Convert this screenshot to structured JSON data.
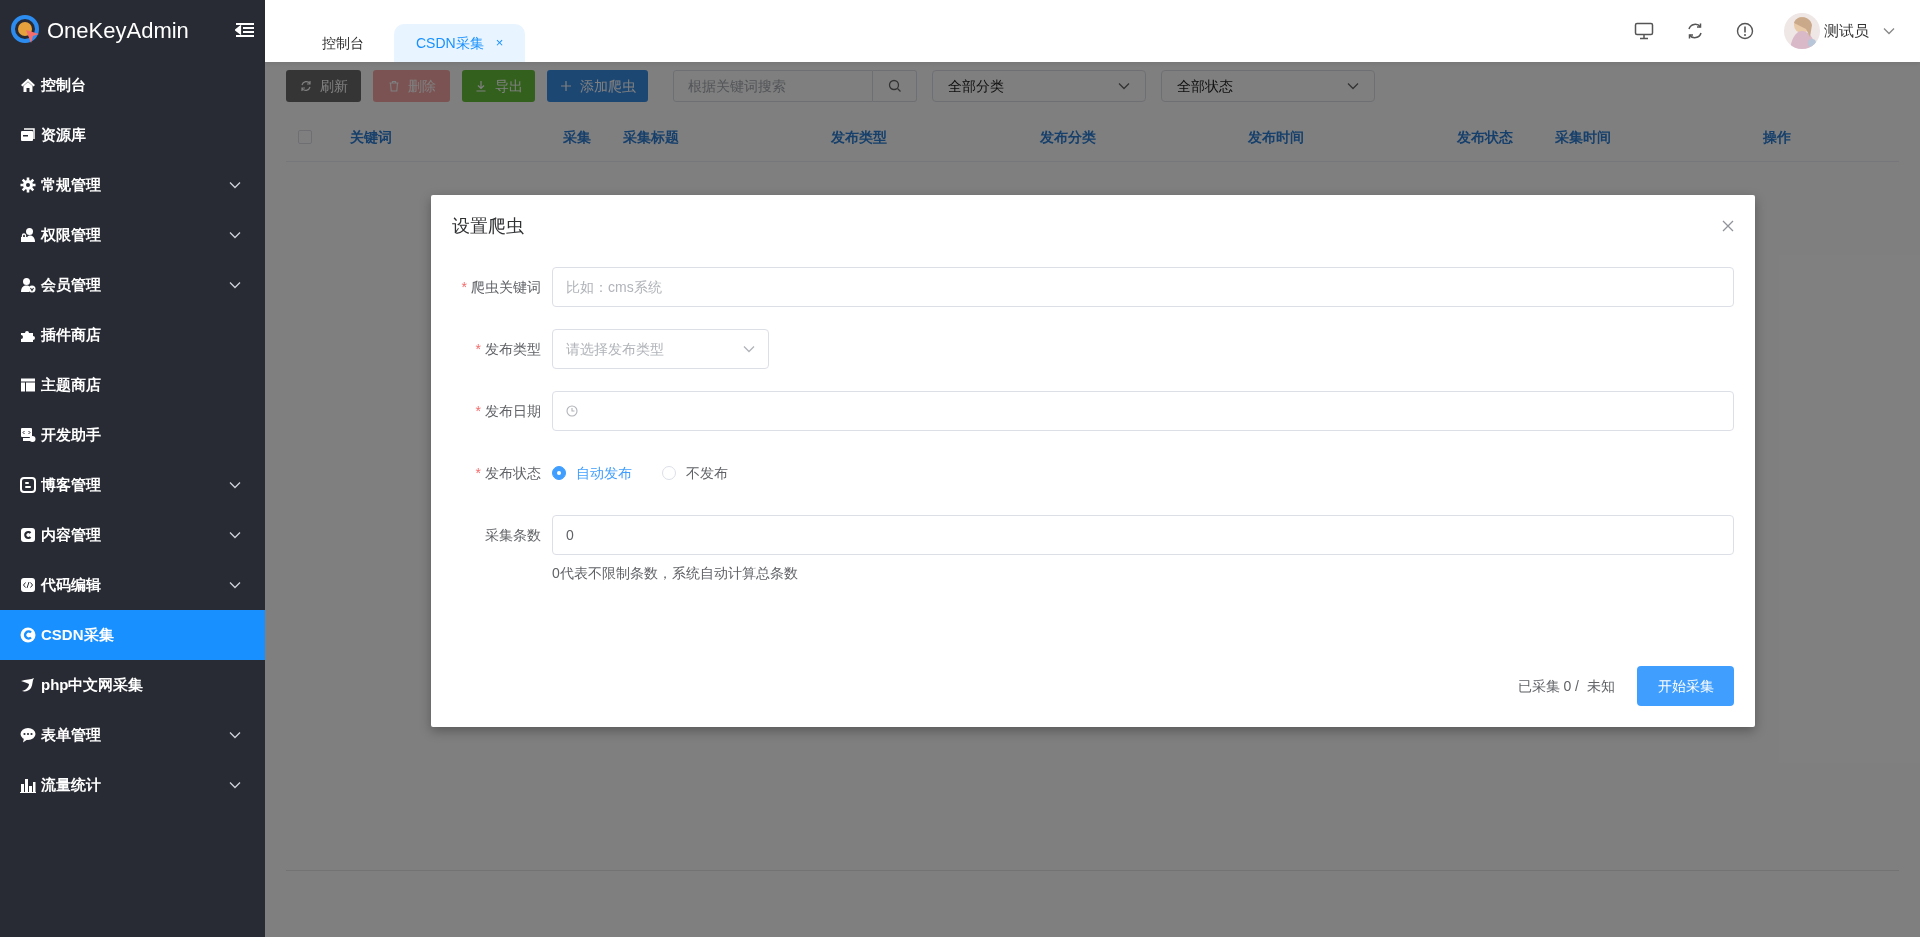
{
  "sidebar": {
    "logo": "OneKeyAdmin",
    "items": [
      {
        "label": "控制台",
        "expandable": false,
        "selected": false
      },
      {
        "label": "资源库",
        "expandable": false,
        "selected": false
      },
      {
        "label": "常规管理",
        "expandable": true,
        "selected": false
      },
      {
        "label": "权限管理",
        "expandable": true,
        "selected": false
      },
      {
        "label": "会员管理",
        "expandable": true,
        "selected": false
      },
      {
        "label": "插件商店",
        "expandable": false,
        "selected": false
      },
      {
        "label": "主题商店",
        "expandable": false,
        "selected": false
      },
      {
        "label": "开发助手",
        "expandable": false,
        "selected": false
      },
      {
        "label": "博客管理",
        "expandable": true,
        "selected": false
      },
      {
        "label": "内容管理",
        "expandable": true,
        "selected": false
      },
      {
        "label": "代码编辑",
        "expandable": true,
        "selected": false
      },
      {
        "label": "CSDN采集",
        "expandable": false,
        "selected": true
      },
      {
        "label": "php中文网采集",
        "expandable": false,
        "selected": false
      },
      {
        "label": "表单管理",
        "expandable": true,
        "selected": false
      },
      {
        "label": "流量统计",
        "expandable": true,
        "selected": false
      }
    ]
  },
  "tabs": [
    {
      "label": "控制台",
      "selected": false,
      "closable": false
    },
    {
      "label": "CSDN采集",
      "selected": true,
      "closable": true,
      "close": "×"
    }
  ],
  "user": {
    "name": "测试员"
  },
  "toolbar": {
    "buttons": [
      {
        "label": "刷新",
        "kind": "refresh",
        "disabled": false
      },
      {
        "label": "删除",
        "kind": "delete",
        "disabled": true
      },
      {
        "label": "导出",
        "kind": "export",
        "disabled": false
      },
      {
        "label": "添加爬虫",
        "kind": "add",
        "disabled": false
      }
    ],
    "search": {
      "placeholder": "根据关键词搜索"
    },
    "filters": [
      {
        "value": "全部分类"
      },
      {
        "value": "全部状态"
      }
    ]
  },
  "table": {
    "select_all_checked": false,
    "columns": [
      "关键词",
      "采集",
      "采集标题",
      "发布类型",
      "发布分类",
      "发布时间",
      "发布状态",
      "采集时间",
      "操作"
    ]
  },
  "dialog": {
    "title": "设置爬虫",
    "fields": [
      {
        "kind": "text",
        "label": "爬虫关键词",
        "required": "*",
        "placeholder": "比如：cms系统"
      },
      {
        "kind": "select",
        "label": "发布类型",
        "required": "*",
        "placeholder": "请选择发布类型"
      },
      {
        "kind": "date",
        "label": "发布日期",
        "required": "*"
      },
      {
        "kind": "radio",
        "label": "发布状态",
        "required": "*",
        "options": [
          {
            "label": "自动发布",
            "selected": true
          },
          {
            "label": "不发布",
            "selected": false
          }
        ]
      },
      {
        "kind": "number",
        "label": "采集条数",
        "value": "0",
        "hint": "0代表不限制条数，系统自动计算总条数"
      }
    ],
    "progress": "已采集 0 /",
    "total": "未知",
    "submit": "开始采集"
  }
}
